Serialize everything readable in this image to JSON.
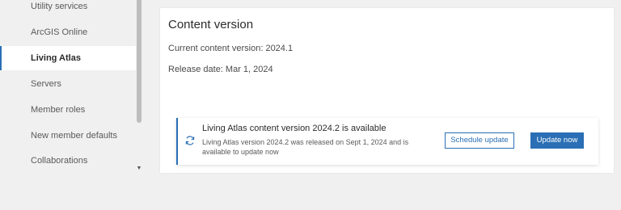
{
  "sidebar": {
    "items": [
      {
        "label": "Utility services"
      },
      {
        "label": "ArcGIS Online"
      },
      {
        "label": "Living Atlas"
      },
      {
        "label": "Servers"
      },
      {
        "label": "Member roles"
      },
      {
        "label": "New member defaults"
      },
      {
        "label": "Collaborations"
      }
    ],
    "active_item": "Living Atlas"
  },
  "panel": {
    "title": "Content version",
    "current_version": "Current content version: 2024.1",
    "release_date": "Release date: Mar 1, 2024"
  },
  "notice": {
    "icon": "refresh-icon",
    "title": "Living Atlas content version 2024.2 is available",
    "body": "Living Atlas version 2024.2 was released on Sept 1, 2024 and is available to update now",
    "schedule_label": "Schedule update",
    "update_label": "Update now"
  },
  "colors": {
    "accent": "#2a6fb5",
    "background": "#f0f0f0",
    "panel": "#ffffff"
  }
}
